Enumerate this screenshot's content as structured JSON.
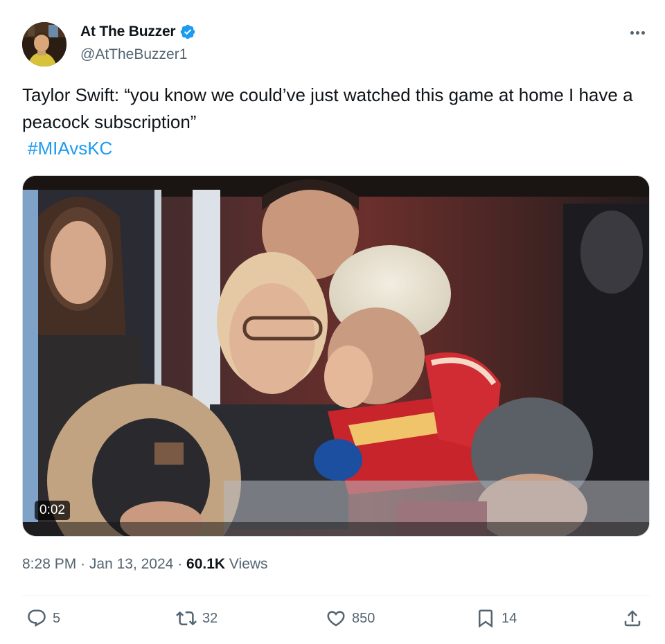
{
  "author": {
    "display_name": "At The Buzzer",
    "handle": "@AtTheBuzzer1",
    "verified": true,
    "verified_color": "#1d9bf0"
  },
  "tweet": {
    "text": "Taylor Swift: “you know we could’ve just watched this game at home I have a peacock subscription”",
    "hashtag": "#MIAvsKC",
    "hashtag_color": "#1d9bf0"
  },
  "media": {
    "type": "video",
    "duration": "0:02"
  },
  "meta": {
    "time": "8:28 PM",
    "separator": "·",
    "date": "Jan 13, 2024",
    "views_count": "60.1K",
    "views_label": "Views"
  },
  "actions": {
    "reply": {
      "icon": "reply-icon",
      "count": "5"
    },
    "retweet": {
      "icon": "retweet-icon",
      "count": "32"
    },
    "like": {
      "icon": "heart-icon",
      "count": "850"
    },
    "bookmark": {
      "icon": "bookmark-icon",
      "count": "14"
    },
    "share": {
      "icon": "share-icon"
    }
  },
  "colors": {
    "text_primary": "#0f1419",
    "text_secondary": "#536471",
    "divider": "#eff3f4"
  }
}
